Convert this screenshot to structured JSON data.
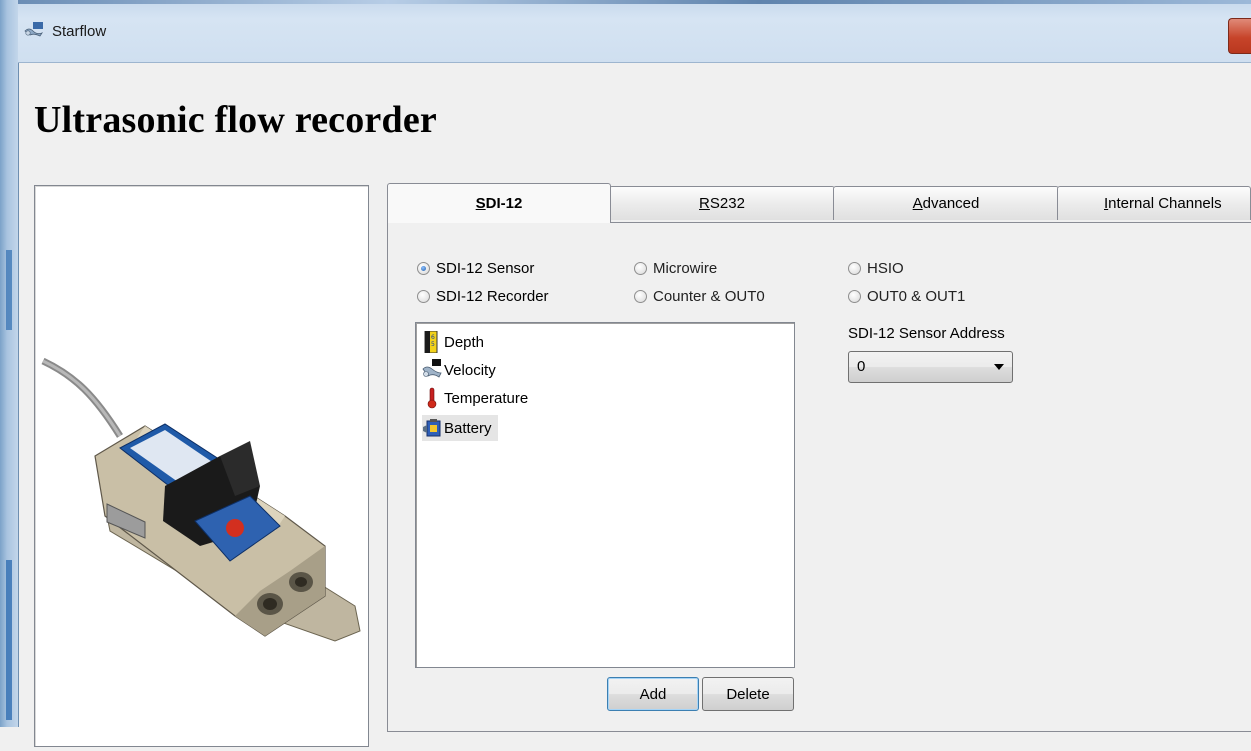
{
  "window": {
    "title": "Starflow",
    "icon": "starflow-app-icon"
  },
  "heading": "Ultrasonic flow recorder",
  "tabs": [
    {
      "label_pre": "",
      "mnemonic": "S",
      "label_post": "DI-12",
      "active": true
    },
    {
      "label_pre": "",
      "mnemonic": "R",
      "label_post": "S232",
      "active": false
    },
    {
      "label_pre": "",
      "mnemonic": "A",
      "label_post": "dvanced",
      "active": false
    },
    {
      "label_pre": "",
      "mnemonic": "I",
      "label_post": "nternal Channels",
      "active": false
    }
  ],
  "radios": {
    "sdi12_sensor": {
      "label": "SDI-12 Sensor",
      "checked": true
    },
    "sdi12_recorder": {
      "label": "SDI-12 Recorder",
      "checked": false
    },
    "microwire": {
      "label": "Microwire",
      "checked": false
    },
    "counter_out0": {
      "label": "Counter  & OUT0",
      "checked": false
    },
    "hsio": {
      "label": "HSIO",
      "checked": false
    },
    "out0_out1": {
      "label": "OUT0 & OUT1",
      "checked": false
    }
  },
  "channels": [
    {
      "label": "Depth",
      "icon": "depth-ruler-icon"
    },
    {
      "label": "Velocity",
      "icon": "velocity-icon"
    },
    {
      "label": "Temperature",
      "icon": "thermometer-icon"
    },
    {
      "label": "Battery",
      "icon": "battery-icon",
      "selected": true
    }
  ],
  "buttons": {
    "add": "Add",
    "delete": "Delete"
  },
  "sensor_address": {
    "label": "SDI-12 Sensor Address",
    "value": "0"
  },
  "colors": {
    "close_button": "#c7442a",
    "selection": "#e5e5e5",
    "radio_checked": "#1f5ca8"
  }
}
